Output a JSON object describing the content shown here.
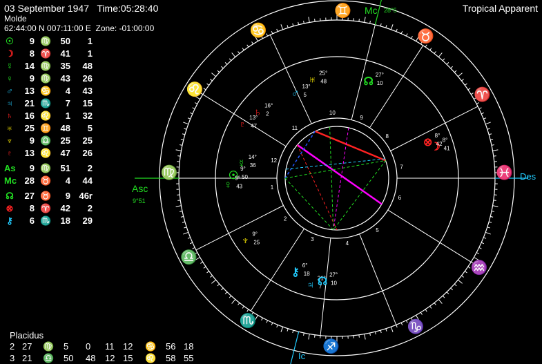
{
  "header": {
    "datetime": "03 September 1947   Time:05:28:40",
    "place": "Molde",
    "coords": "62:44:00 N 007:11:00 E  Zone: -01:00:00",
    "mode": "Tropical Apparent"
  },
  "planet_table": [
    {
      "icon": "sun-icon",
      "glyph": "☉",
      "color": "#22dd22",
      "deg": "9",
      "sign": "♍",
      "sign_color": "#22dd22",
      "min": "50",
      "sec": "1"
    },
    {
      "icon": "moon-icon",
      "glyph": "☽",
      "color": "#ff2222",
      "deg": "8",
      "sign": "♈",
      "sign_color": "#ff2222",
      "min": "41",
      "sec": "1"
    },
    {
      "icon": "mercury-icon",
      "glyph": "☿",
      "color": "#22dd22",
      "deg": "14",
      "sign": "♍",
      "sign_color": "#22dd22",
      "min": "35",
      "sec": "48"
    },
    {
      "icon": "venus-icon",
      "glyph": "♀",
      "color": "#22dd22",
      "deg": "9",
      "sign": "♍",
      "sign_color": "#22dd22",
      "min": "43",
      "sec": "26"
    },
    {
      "icon": "mars-icon",
      "glyph": "♂",
      "color": "#22ccff",
      "deg": "13",
      "sign": "♋",
      "sign_color": "#22ccff",
      "min": "4",
      "sec": "43"
    },
    {
      "icon": "jupiter-icon",
      "glyph": "♃",
      "color": "#22ccff",
      "deg": "21",
      "sign": "♏",
      "sign_color": "#22ccff",
      "min": "7",
      "sec": "15"
    },
    {
      "icon": "saturn-icon",
      "glyph": "♄",
      "color": "#ff2222",
      "deg": "16",
      "sign": "♌",
      "sign_color": "#ff2222",
      "min": "1",
      "sec": "32"
    },
    {
      "icon": "uranus-icon",
      "glyph": "♅",
      "color": "#ffee00",
      "deg": "25",
      "sign": "♊",
      "sign_color": "#ffee00",
      "min": "48",
      "sec": "5"
    },
    {
      "icon": "neptune-icon",
      "glyph": "♆",
      "color": "#ffee00",
      "deg": "9",
      "sign": "♎",
      "sign_color": "#ffee00",
      "min": "25",
      "sec": "25"
    },
    {
      "icon": "pluto-icon",
      "glyph": "♇",
      "color": "#ff2222",
      "deg": "13",
      "sign": "♌",
      "sign_color": "#ff2222",
      "min": "47",
      "sec": "26"
    },
    {
      "icon": "ascendant-icon",
      "glyph": "As",
      "color": "#22dd22",
      "deg": "9",
      "sign": "♍",
      "sign_color": "#22dd22",
      "min": "51",
      "sec": "2"
    },
    {
      "icon": "midheaven-icon",
      "glyph": "Mc",
      "color": "#22dd22",
      "deg": "28",
      "sign": "♉",
      "sign_color": "#22dd22",
      "min": "4",
      "sec": "44"
    },
    {
      "icon": "node-icon",
      "glyph": "☊",
      "color": "#22dd22",
      "deg": "27",
      "sign": "♉",
      "sign_color": "#22dd22",
      "min": "9",
      "sec": "46r"
    },
    {
      "icon": "part-of-fortune-icon",
      "glyph": "⊗",
      "color": "#ff2222",
      "deg": "8",
      "sign": "♈",
      "sign_color": "#ff2222",
      "min": "42",
      "sec": "2"
    },
    {
      "icon": "chiron-icon",
      "glyph": "⚷",
      "color": "#22ccff",
      "deg": "6",
      "sign": "♏",
      "sign_color": "#22ccff",
      "min": "18",
      "sec": "29"
    }
  ],
  "houses": {
    "system": "Placidus",
    "rows": [
      {
        "a": "2",
        "b": "27",
        "s1": "♍",
        "s1c": "#22dd22",
        "c": "5",
        "d": "0",
        "e": "11",
        "f": "12",
        "s2": "♋",
        "s2c": "#22ccff",
        "g": "56",
        "h": "18"
      },
      {
        "a": "3",
        "b": "21",
        "s1": "♎",
        "s1c": "#ffee00",
        "c": "50",
        "d": "48",
        "e": "12",
        "f": "15",
        "s2": "♌",
        "s2c": "#ff2222",
        "g": "58",
        "h": "55"
      }
    ]
  },
  "wheel": {
    "mc_label": "Mc",
    "mc_value": "28°5",
    "asc_label": "Asc",
    "asc_value": "9°51",
    "des_label": "Des",
    "ic_label": "Ic",
    "house_numbers": [
      "1",
      "2",
      "3",
      "4",
      "5",
      "6",
      "7",
      "8",
      "9",
      "10",
      "11",
      "12"
    ],
    "signs": [
      {
        "icon": "taurus-icon",
        "glyph": "♉",
        "color": "#22dd22"
      },
      {
        "icon": "aries-icon",
        "glyph": "♈",
        "color": "#ff2222"
      },
      {
        "icon": "pisces-icon",
        "glyph": "♓",
        "color": "#22ccff"
      },
      {
        "icon": "aquarius-icon",
        "glyph": "♒",
        "color": "#ffee00"
      },
      {
        "icon": "capricorn-icon",
        "glyph": "♑",
        "color": "#22dd22"
      },
      {
        "icon": "sagittarius-icon",
        "glyph": "♐",
        "color": "#ff2222"
      },
      {
        "icon": "scorpio-icon",
        "glyph": "♏",
        "color": "#22ccff"
      },
      {
        "icon": "libra-icon",
        "glyph": "♎",
        "color": "#ffee00"
      },
      {
        "icon": "virgo-icon",
        "glyph": "♍",
        "color": "#22dd22"
      },
      {
        "icon": "leo-icon",
        "glyph": "♌",
        "color": "#ff2222"
      },
      {
        "icon": "cancer-icon",
        "glyph": "♋",
        "color": "#22ccff"
      },
      {
        "icon": "gemini-icon",
        "glyph": "♊",
        "color": "#ffee00"
      }
    ],
    "placements": [
      {
        "icon": "uranus-icon",
        "glyph": "♅",
        "color": "#ffee00",
        "deg": "25",
        "min": "48"
      },
      {
        "icon": "node-icon",
        "glyph": "☊",
        "color": "#22dd22",
        "deg": "27",
        "min": "10"
      },
      {
        "icon": "mars-icon",
        "glyph": "♂",
        "color": "#22ccff",
        "deg": "13",
        "min": "5"
      },
      {
        "icon": "saturn-icon",
        "glyph": "♄",
        "color": "#ff2222",
        "deg": "16",
        "min": "2"
      },
      {
        "icon": "pluto-icon",
        "glyph": "♇",
        "color": "#ff2222",
        "deg": "13",
        "min": "47"
      },
      {
        "icon": "sun-icon",
        "glyph": "☉",
        "color": "#22dd22",
        "deg": "9",
        "min": "50"
      },
      {
        "icon": "venus-icon",
        "glyph": "♀",
        "color": "#22dd22",
        "deg": "9",
        "min": "43"
      },
      {
        "icon": "mercury-icon",
        "glyph": "☿",
        "color": "#22dd22",
        "deg": "14",
        "min": "36"
      },
      {
        "icon": "neptune-icon",
        "glyph": "♆",
        "color": "#ffee00",
        "deg": "9",
        "min": "25"
      },
      {
        "icon": "chiron-icon",
        "glyph": "⚷",
        "color": "#22ccff",
        "deg": "6",
        "min": "18"
      },
      {
        "icon": "jupiter-icon",
        "glyph": "♃",
        "color": "#22ccff",
        "deg": "21",
        "min": "7"
      },
      {
        "icon": "node-icon",
        "glyph": "☊",
        "color": "#22ccff",
        "deg": "27",
        "min": "10"
      },
      {
        "icon": "moon-icon",
        "glyph": "☽",
        "color": "#ff2222",
        "deg": "8",
        "min": "41"
      },
      {
        "icon": "part-of-fortune-icon",
        "glyph": "⊗",
        "color": "#ff2222",
        "deg": "8",
        "min": "42"
      }
    ]
  }
}
